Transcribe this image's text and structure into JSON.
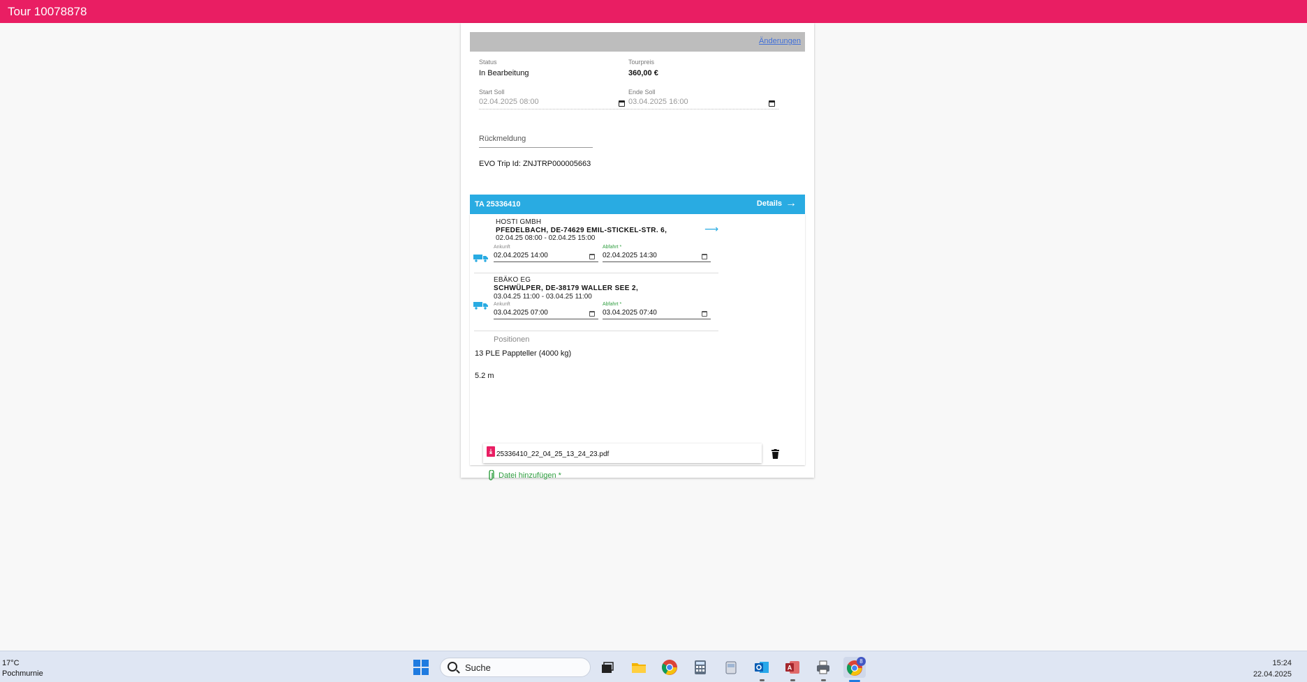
{
  "app": {
    "title": "Tour 10078878"
  },
  "tour": {
    "changes_link": "Änderungen",
    "status_label": "Status",
    "status_value": "In Bearbeitung",
    "price_label": "Tourpreis",
    "price_value": "360,00 €",
    "start_label": "Start Soll",
    "start_value": "02.04.2025 08:00",
    "end_label": "Ende Soll",
    "end_value": "03.04.2025 16:00",
    "feedback_placeholder": "Rückmeldung",
    "evo_trip": "EVO Trip Id: ZNJTRP000005663"
  },
  "transport": {
    "title": "TA 25336410",
    "details_label": "Details",
    "stops": [
      {
        "name": "HOSTI GMBH",
        "address": "PFEDELBACH, DE-74629 EMIL-STICKEL-STR. 6,",
        "window": "02.04.25 08:00 - 02.04.25 15:00",
        "arrival_label": "Ankunft",
        "arrival_value": "02.04.2025 14:00",
        "departure_label": "Abfahrt *",
        "departure_value": "02.04.2025 14:30"
      },
      {
        "name": "EBÄKO EG",
        "address": "SCHWÜLPER, DE-38179 WALLER SEE 2,",
        "window": "03.04.25 11:00 - 03.04.25 11:00",
        "arrival_label": "Ankunft",
        "arrival_value": "03.04.2025 07:00",
        "departure_label": "Abfahrt *",
        "departure_value": "03.04.2025 07:40"
      }
    ],
    "positions_label": "Positionen",
    "position_line": "13 PLE Pappteller (4000 kg)",
    "length": "5.2 m",
    "file_name": "25336410_22_04_25_13_24_23.pdf",
    "add_file_label": "Datei hinzufügen *"
  },
  "taskbar": {
    "temperature": "17°C",
    "location": "Pochmurnie",
    "search_placeholder": "Suche",
    "time": "15:24",
    "date": "22.04.2025",
    "chrome_badge": "8"
  },
  "colors": {
    "appbar": "#e91e63",
    "transport_header": "#29abe2",
    "required_green": "#2e9e3f"
  }
}
